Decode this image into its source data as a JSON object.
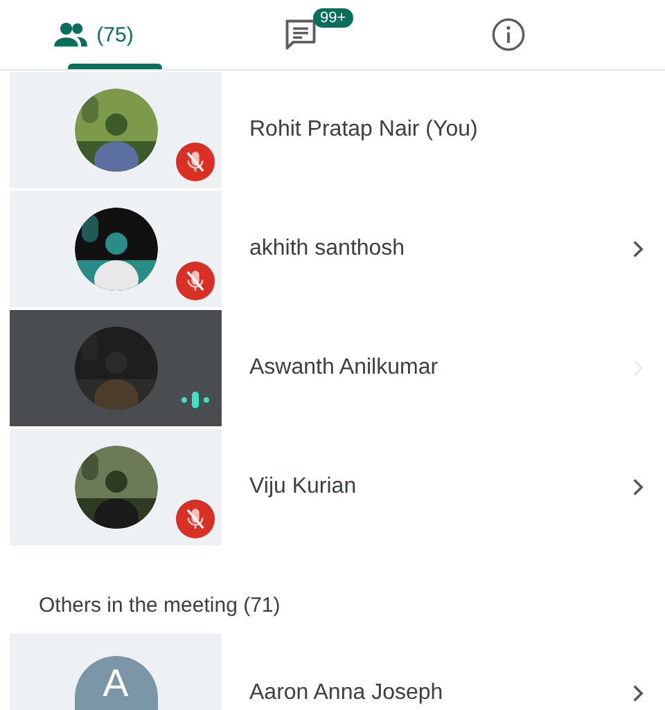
{
  "tabs": [
    {
      "kind": "people",
      "label": "(75)",
      "selected": true
    },
    {
      "kind": "chat",
      "badge": "99+",
      "selected": false
    },
    {
      "kind": "info",
      "selected": false
    }
  ],
  "participants": [
    {
      "name": "Rohit Pratap Nair (You)",
      "muted": true,
      "speaking": false,
      "chevron": false
    },
    {
      "name": "akhith santhosh",
      "muted": true,
      "speaking": false,
      "chevron": true
    },
    {
      "name": "Aswanth Anilkumar",
      "muted": false,
      "speaking": true,
      "chevron": true
    },
    {
      "name": "Viju Kurian",
      "muted": true,
      "speaking": false,
      "chevron": true
    }
  ],
  "others": {
    "heading": "Others in the meeting (71)",
    "participants": [
      {
        "name": "Aaron Anna Joseph",
        "avatar": {
          "kind": "letter",
          "initial": "A"
        },
        "muted": false,
        "speaking": false,
        "chevron": true
      }
    ]
  }
}
